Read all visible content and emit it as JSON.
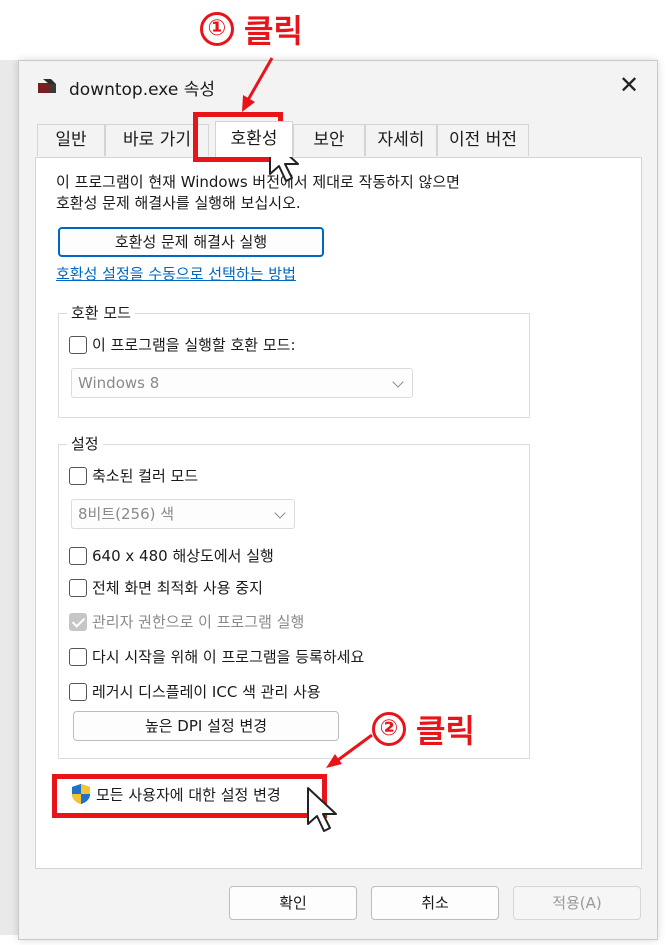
{
  "annotations": {
    "step1": {
      "num": "①",
      "text": "클릭"
    },
    "step2": {
      "num": "②",
      "text": "클릭"
    }
  },
  "window": {
    "title": "downtop.exe 속성",
    "close_glyph": "✕"
  },
  "tabs": [
    {
      "label": "일반"
    },
    {
      "label": "바로 가기"
    },
    {
      "label": "호환성",
      "active": true
    },
    {
      "label": "보안"
    },
    {
      "label": "자세히"
    },
    {
      "label": "이전 버전"
    }
  ],
  "compat": {
    "description_line1": "이 프로그램이 현재 Windows 버전에서 제대로 작동하지 않으면",
    "description_line2": "호환성 문제 해결사를 실행해 보십시오.",
    "troubleshooter_button": "호환성 문제 해결사 실행",
    "manual_link": "호환성 설정을 수동으로 선택하는 방법",
    "mode_group": {
      "title": "호환 모드",
      "checkbox_label": "이 프로그램을 실행할 호환 모드:",
      "selected_os": "Windows 8"
    },
    "settings_group": {
      "title": "설정",
      "reduced_color": "축소된 컬러 모드",
      "color_select": "8비트(256) 색",
      "res_640": "640 x 480 해상도에서 실행",
      "disable_fullscreen": "전체 화면 최적화 사용 중지",
      "run_as_admin": "관리자 권한으로 이 프로그램 실행",
      "register_restart": "다시 시작을 위해 이 프로그램을 등록하세요",
      "legacy_icc": "레거시 디스플레이 ICC 색 관리 사용",
      "dpi_button": "높은 DPI 설정 변경"
    },
    "all_users_button": "모든 사용자에 대한 설정 변경"
  },
  "footer": {
    "ok": "확인",
    "cancel": "취소",
    "apply": "적용(A)"
  },
  "colors": {
    "annotation_red": "#e8141a",
    "link_blue": "#0067c0"
  }
}
